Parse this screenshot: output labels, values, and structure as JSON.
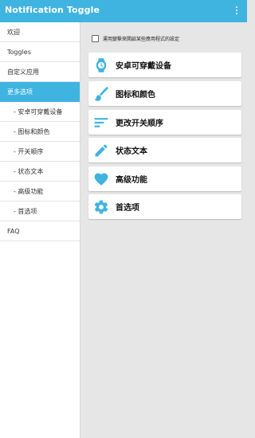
{
  "app": {
    "title": "Notification Toggle",
    "accent_color": "#3fb4e1",
    "overflow_icon": "more-vert-icon"
  },
  "sidebar": {
    "items": [
      {
        "label": "欢迎",
        "active": false
      },
      {
        "label": "Toggles",
        "active": false
      },
      {
        "label": "自定义应用",
        "active": false
      },
      {
        "label": "更多选项",
        "active": true
      },
      {
        "label": "- 安卓可穿戴设备",
        "active": false
      },
      {
        "label": "- 图标和颜色",
        "active": false
      },
      {
        "label": "- 开关顺序",
        "active": false
      },
      {
        "label": "- 状态文本",
        "active": false
      },
      {
        "label": "- 高级功能",
        "active": false
      },
      {
        "label": "- 首选项",
        "active": false
      },
      {
        "label": "FAQ",
        "active": false
      }
    ]
  },
  "main": {
    "checkbox_label": "運用變擊來開啟某些應用程式的設定",
    "checkbox_checked": false,
    "cards": [
      {
        "label": "安卓可穿戴设备",
        "icon": "watch-icon"
      },
      {
        "label": "图标和颜色",
        "icon": "brush-icon"
      },
      {
        "label": "更改开关顺序",
        "icon": "sort-icon"
      },
      {
        "label": "状态文本",
        "icon": "pencil-icon"
      },
      {
        "label": "高级功能",
        "icon": "heart-icon"
      },
      {
        "label": "首选项",
        "icon": "gear-icon"
      }
    ]
  }
}
